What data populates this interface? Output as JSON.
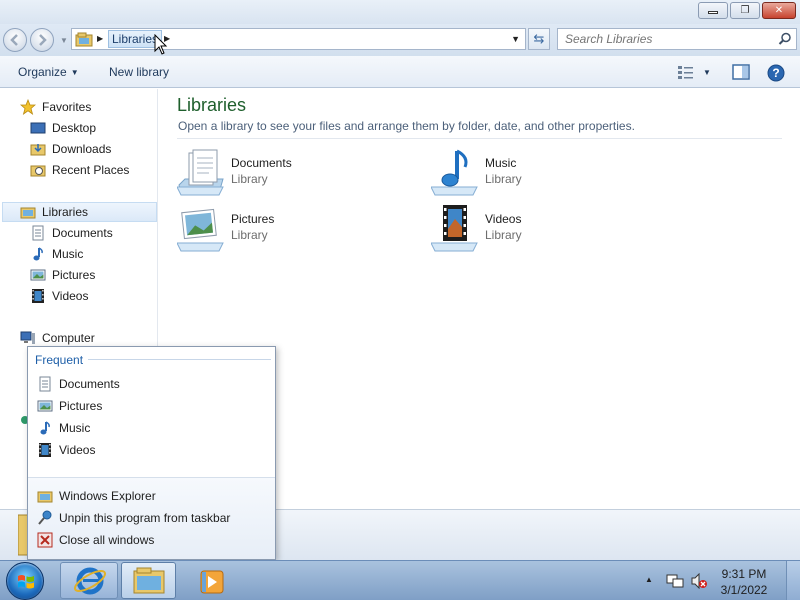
{
  "window": {
    "minimize_icon": "minimize-icon",
    "maximize_icon": "restore-icon",
    "close_icon": "close-icon"
  },
  "navbar": {
    "breadcrumb": [
      "Libraries"
    ],
    "search_placeholder": "Search Libraries"
  },
  "toolbar": {
    "organize_label": "Organize",
    "new_library_label": "New library"
  },
  "navpane": {
    "favorites": {
      "label": "Favorites",
      "items": [
        {
          "label": "Desktop",
          "icon": "desktop-icon"
        },
        {
          "label": "Downloads",
          "icon": "downloads-folder-icon"
        },
        {
          "label": "Recent Places",
          "icon": "recent-places-icon"
        }
      ]
    },
    "libraries": {
      "label": "Libraries",
      "items": [
        {
          "label": "Documents",
          "icon": "documents-icon"
        },
        {
          "label": "Music",
          "icon": "music-icon"
        },
        {
          "label": "Pictures",
          "icon": "pictures-icon"
        },
        {
          "label": "Videos",
          "icon": "videos-icon"
        }
      ]
    },
    "computer": {
      "label": "Computer"
    }
  },
  "content": {
    "title": "Libraries",
    "subtitle": "Open a library to see your files and arrange them by folder, date, and other properties.",
    "libraries": [
      {
        "name": "Documents",
        "kind": "Library",
        "icon": "documents-library-icon"
      },
      {
        "name": "Music",
        "kind": "Library",
        "icon": "music-library-icon"
      },
      {
        "name": "Pictures",
        "kind": "Library",
        "icon": "pictures-library-icon"
      },
      {
        "name": "Videos",
        "kind": "Library",
        "icon": "videos-library-icon"
      }
    ]
  },
  "jumplist": {
    "header": "Frequent",
    "frequent": [
      {
        "label": "Documents",
        "icon": "documents-icon"
      },
      {
        "label": "Pictures",
        "icon": "pictures-icon"
      },
      {
        "label": "Music",
        "icon": "music-icon"
      },
      {
        "label": "Videos",
        "icon": "videos-icon"
      }
    ],
    "tasks": [
      {
        "label": "Windows Explorer",
        "icon": "explorer-folder-icon"
      },
      {
        "label": "Unpin this program from taskbar",
        "icon": "unpin-icon"
      },
      {
        "label": "Close all windows",
        "icon": "close-windows-icon"
      }
    ]
  },
  "taskbar": {
    "time": "9:31 PM",
    "date": "3/1/2022",
    "pinned": [
      "start-orb",
      "internet-explorer-icon",
      "windows-explorer-icon",
      "media-player-icon"
    ]
  },
  "colors": {
    "title_green": "#1e5f2c",
    "link_blue": "#1e395b",
    "taskbar": "#98b4d8"
  }
}
